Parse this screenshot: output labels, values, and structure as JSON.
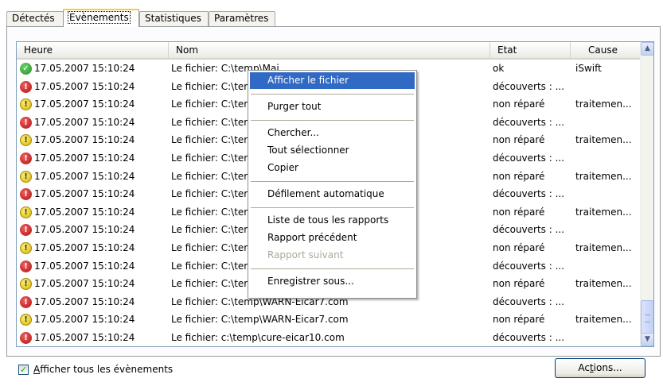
{
  "tabs": [
    {
      "label": "Détectés",
      "active": false
    },
    {
      "label": "Evènements",
      "active": true
    },
    {
      "label": "Statistiques",
      "active": false
    },
    {
      "label": "Paramètres",
      "active": false
    }
  ],
  "columns": {
    "heure": "Heure",
    "nom": "Nom",
    "etat": "Etat",
    "cause": "Cause"
  },
  "rows": [
    {
      "status": "ok-icon",
      "heure": "17.05.2007 15:10:24",
      "nom": "Le fichier: C:\\temp\\Mai...",
      "etat": "ok",
      "cause": "iSwift"
    },
    {
      "status": "error-icon",
      "heure": "17.05.2007 15:10:24",
      "nom": "Le fichier: C:\\tem",
      "etat": "découverts : ...",
      "cause": ""
    },
    {
      "status": "warning-icon",
      "heure": "17.05.2007 15:10:24",
      "nom": "Le fichier: C:\\tem",
      "etat": "non réparé",
      "cause": "traitemen..."
    },
    {
      "status": "error-icon",
      "heure": "17.05.2007 15:10:24",
      "nom": "Le fichier: C:\\tem",
      "etat": "découverts : ...",
      "cause": ""
    },
    {
      "status": "warning-icon",
      "heure": "17.05.2007 15:10:24",
      "nom": "Le fichier: C:\\tem",
      "etat": "non réparé",
      "cause": "traitemen..."
    },
    {
      "status": "error-icon",
      "heure": "17.05.2007 15:10:24",
      "nom": "Le fichier: C:\\tem",
      "etat": "découverts : ...",
      "cause": ""
    },
    {
      "status": "warning-icon",
      "heure": "17.05.2007 15:10:24",
      "nom": "Le fichier: C:\\tem",
      "etat": "non réparé",
      "cause": "traitemen..."
    },
    {
      "status": "error-icon",
      "heure": "17.05.2007 15:10:24",
      "nom": "Le fichier: C:\\tem",
      "etat": "découverts : ...",
      "cause": ""
    },
    {
      "status": "warning-icon",
      "heure": "17.05.2007 15:10:24",
      "nom": "Le fichier: C:\\tem",
      "etat": "non réparé",
      "cause": "traitemen..."
    },
    {
      "status": "error-icon",
      "heure": "17.05.2007 15:10:24",
      "nom": "Le fichier: C:\\tem",
      "etat": "découverts : ...",
      "cause": ""
    },
    {
      "status": "warning-icon",
      "heure": "17.05.2007 15:10:24",
      "nom": "Le fichier: C:\\tem",
      "etat": "non réparé",
      "cause": "traitemen..."
    },
    {
      "status": "error-icon",
      "heure": "17.05.2007 15:10:24",
      "nom": "Le fichier: C:\\tem",
      "etat": "découverts : ...",
      "cause": ""
    },
    {
      "status": "warning-icon",
      "heure": "17.05.2007 15:10:24",
      "nom": "Le fichier: C:\\tem",
      "etat": "non réparé",
      "cause": "traitemen..."
    },
    {
      "status": "error-icon",
      "heure": "17.05.2007 15:10:24",
      "nom": "Le fichier: C:\\temp\\WARN-Eicar7.com",
      "etat": "découverts : ...",
      "cause": ""
    },
    {
      "status": "warning-icon",
      "heure": "17.05.2007 15:10:24",
      "nom": "Le fichier: C:\\temp\\WARN-Eicar7.com",
      "etat": "non réparé",
      "cause": "traitemen..."
    },
    {
      "status": "error-icon",
      "heure": "17.05.2007 15:10:24",
      "nom": "Le fichier: c:\\temp\\cure-eicar10.com",
      "etat": "découverts : ...",
      "cause": ""
    }
  ],
  "context_menu": [
    {
      "label": "Afficher le fichier",
      "highlighted": true
    },
    {
      "separator": true
    },
    {
      "label": "Purger tout"
    },
    {
      "separator": true
    },
    {
      "label": "Chercher..."
    },
    {
      "label": "Tout sélectionner"
    },
    {
      "label": "Copier"
    },
    {
      "separator": true
    },
    {
      "label": "Défilement automatique"
    },
    {
      "separator": true
    },
    {
      "label": "Liste de tous les rapports"
    },
    {
      "label": "Rapport précédent"
    },
    {
      "label": "Rapport suivant",
      "disabled": true
    },
    {
      "separator": true
    },
    {
      "label": "Enregistrer sous..."
    }
  ],
  "show_all_events": {
    "checked": true,
    "label_first": "A",
    "label_rest": "fficher tous les évènements"
  },
  "actions_button": {
    "label_pre": "Ac",
    "label_ul": "t",
    "label_post": "ions..."
  },
  "colors": {
    "menu_highlight": "#316ac5",
    "active_tab_accent": "#ffc83c",
    "disabled_text": "#aca899"
  }
}
